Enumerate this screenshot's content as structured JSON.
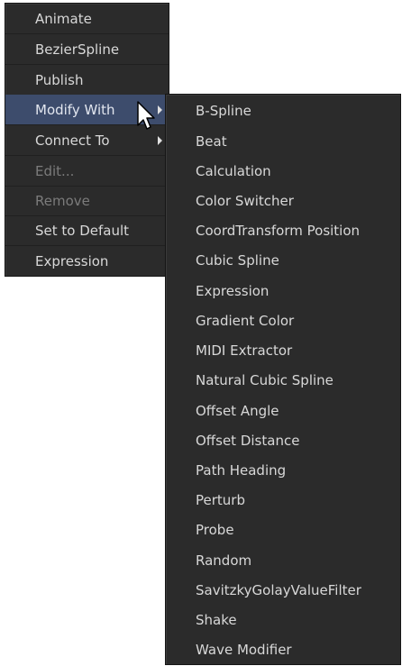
{
  "main_menu": {
    "items": [
      {
        "label": "Animate",
        "state": "normal"
      },
      {
        "label": "BezierSpline",
        "state": "normal"
      },
      {
        "label": "Publish",
        "state": "normal"
      },
      {
        "label": "Modify With",
        "state": "highlighted",
        "has_submenu": true
      },
      {
        "label": "Connect To",
        "state": "normal",
        "has_submenu": true
      },
      {
        "label": "Edit...",
        "state": "disabled"
      },
      {
        "label": "Remove",
        "state": "disabled"
      },
      {
        "label": "Set to Default",
        "state": "normal"
      },
      {
        "label": "Expression",
        "state": "normal"
      }
    ]
  },
  "sub_menu": {
    "items": [
      {
        "label": "B-Spline"
      },
      {
        "label": "Beat"
      },
      {
        "label": "Calculation"
      },
      {
        "label": "Color Switcher"
      },
      {
        "label": "CoordTransform Position"
      },
      {
        "label": "Cubic Spline"
      },
      {
        "label": "Expression"
      },
      {
        "label": "Gradient Color"
      },
      {
        "label": "MIDI Extractor"
      },
      {
        "label": "Natural Cubic Spline"
      },
      {
        "label": "Offset Angle"
      },
      {
        "label": "Offset Distance"
      },
      {
        "label": "Path Heading"
      },
      {
        "label": "Perturb"
      },
      {
        "label": "Probe"
      },
      {
        "label": "Random"
      },
      {
        "label": "SavitzkyGolayValueFilter"
      },
      {
        "label": "Shake"
      },
      {
        "label": "Wave Modifier"
      }
    ]
  },
  "colors": {
    "menu_background": "#2b2b2b",
    "highlight": "#3d4c6c",
    "text": "#d8d8d8",
    "disabled_text": "#7b7b7b"
  },
  "icons": {
    "submenu_arrow": "triangle-right",
    "cursor": "mouse-pointer-icon"
  }
}
